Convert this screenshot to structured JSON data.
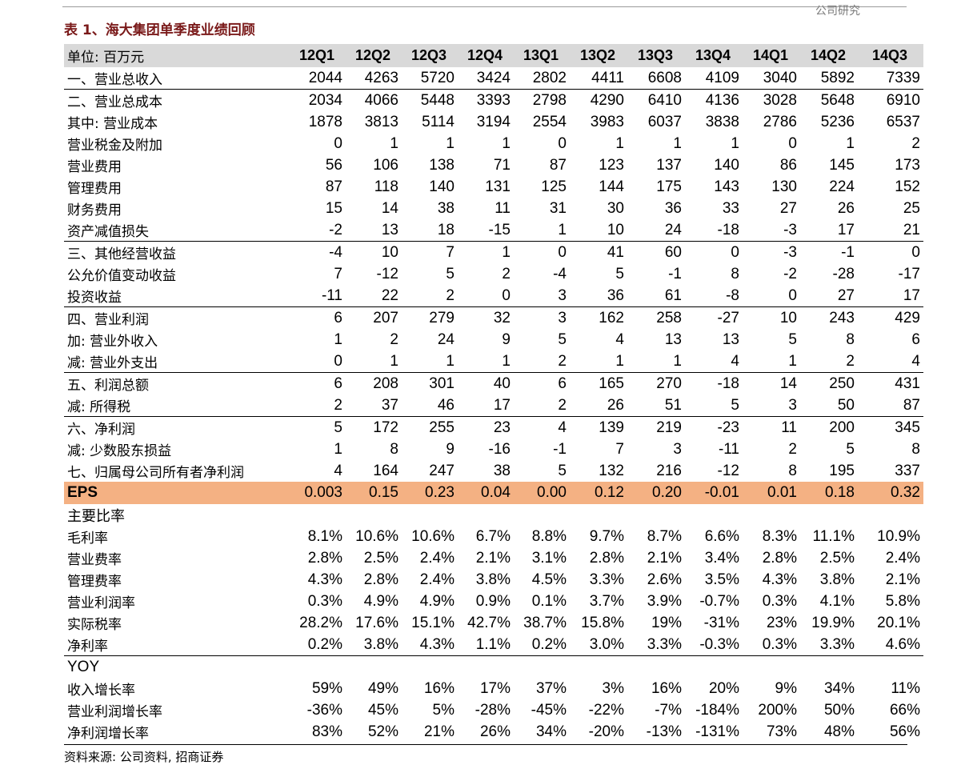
{
  "header_corner": "公司研究",
  "title": "表 1、海大集团单季度业绩回顾",
  "unit_label": "单位: 百万元",
  "quarters": [
    "12Q1",
    "12Q2",
    "12Q3",
    "12Q4",
    "13Q1",
    "13Q2",
    "13Q3",
    "13Q4",
    "14Q1",
    "14Q2",
    "14Q3"
  ],
  "rows": [
    {
      "label": "一、营业总收入",
      "values": [
        "2044",
        "4263",
        "5720",
        "3424",
        "2802",
        "4411",
        "6608",
        "4109",
        "3040",
        "5892",
        "7339"
      ]
    },
    {
      "label": "二、营业总成本",
      "values": [
        "2034",
        "4066",
        "5448",
        "3393",
        "2798",
        "4290",
        "6410",
        "4136",
        "3028",
        "5648",
        "6910"
      ]
    },
    {
      "label": "其中: 营业成本",
      "values": [
        "1878",
        "3813",
        "5114",
        "3194",
        "2554",
        "3983",
        "6037",
        "3838",
        "2786",
        "5236",
        "6537"
      ]
    },
    {
      "label": "营业税金及附加",
      "values": [
        "0",
        "1",
        "1",
        "1",
        "0",
        "1",
        "1",
        "1",
        "0",
        "1",
        "2"
      ]
    },
    {
      "label": "营业费用",
      "values": [
        "56",
        "106",
        "138",
        "71",
        "87",
        "123",
        "137",
        "140",
        "86",
        "145",
        "173"
      ]
    },
    {
      "label": "管理费用",
      "values": [
        "87",
        "118",
        "140",
        "131",
        "125",
        "144",
        "175",
        "143",
        "130",
        "224",
        "152"
      ]
    },
    {
      "label": "财务费用",
      "values": [
        "15",
        "14",
        "38",
        "11",
        "31",
        "30",
        "36",
        "33",
        "27",
        "26",
        "25"
      ]
    },
    {
      "label": "资产减值损失",
      "values": [
        "-2",
        "13",
        "18",
        "-15",
        "1",
        "10",
        "24",
        "-18",
        "-3",
        "17",
        "21"
      ]
    },
    {
      "label": "三、其他经营收益",
      "values": [
        "-4",
        "10",
        "7",
        "1",
        "0",
        "41",
        "60",
        "0",
        "-3",
        "-1",
        "0"
      ]
    },
    {
      "label": "公允价值变动收益",
      "values": [
        "7",
        "-12",
        "5",
        "2",
        "-4",
        "5",
        "-1",
        "8",
        "-2",
        "-28",
        "-17"
      ]
    },
    {
      "label": "投资收益",
      "values": [
        "-11",
        "22",
        "2",
        "0",
        "3",
        "36",
        "61",
        "-8",
        "0",
        "27",
        "17"
      ]
    },
    {
      "label": "四、营业利润",
      "values": [
        "6",
        "207",
        "279",
        "32",
        "3",
        "162",
        "258",
        "-27",
        "10",
        "243",
        "429"
      ]
    },
    {
      "label": "加: 营业外收入",
      "values": [
        "1",
        "2",
        "24",
        "9",
        "5",
        "4",
        "13",
        "13",
        "5",
        "8",
        "6"
      ]
    },
    {
      "label": "减: 营业外支出",
      "values": [
        "0",
        "1",
        "1",
        "1",
        "2",
        "1",
        "1",
        "4",
        "1",
        "2",
        "4"
      ]
    },
    {
      "label": "五、利润总额",
      "values": [
        "6",
        "208",
        "301",
        "40",
        "6",
        "165",
        "270",
        "-18",
        "14",
        "250",
        "431"
      ]
    },
    {
      "label": "减: 所得税",
      "values": [
        "2",
        "37",
        "46",
        "17",
        "2",
        "26",
        "51",
        "5",
        "3",
        "50",
        "87"
      ]
    },
    {
      "label": "六、净利润",
      "values": [
        "5",
        "172",
        "255",
        "23",
        "4",
        "139",
        "219",
        "-23",
        "11",
        "200",
        "345"
      ]
    },
    {
      "label": "减: 少数股东损益",
      "values": [
        "1",
        "8",
        "9",
        "-16",
        "-1",
        "7",
        "3",
        "-11",
        "2",
        "5",
        "8"
      ]
    },
    {
      "label": "七、归属母公司所有者净利润",
      "values": [
        "4",
        "164",
        "247",
        "38",
        "5",
        "132",
        "216",
        "-12",
        "8",
        "195",
        "337"
      ]
    }
  ],
  "eps": {
    "label": "EPS",
    "values": [
      "0.003",
      "0.15",
      "0.23",
      "0.04",
      "0.00",
      "0.12",
      "0.20",
      "-0.01",
      "0.01",
      "0.18",
      "0.32"
    ]
  },
  "ratios": {
    "heading": "主要比率",
    "rows": [
      {
        "label": "毛利率",
        "values": [
          "8.1%",
          "10.6%",
          "10.6%",
          "6.7%",
          "8.8%",
          "9.7%",
          "8.7%",
          "6.6%",
          "8.3%",
          "11.1%",
          "10.9%"
        ]
      },
      {
        "label": "营业费率",
        "values": [
          "2.8%",
          "2.5%",
          "2.4%",
          "2.1%",
          "3.1%",
          "2.8%",
          "2.1%",
          "3.4%",
          "2.8%",
          "2.5%",
          "2.4%"
        ]
      },
      {
        "label": "管理费率",
        "values": [
          "4.3%",
          "2.8%",
          "2.4%",
          "3.8%",
          "4.5%",
          "3.3%",
          "2.6%",
          "3.5%",
          "4.3%",
          "3.8%",
          "2.1%"
        ]
      },
      {
        "label": "营业利润率",
        "values": [
          "0.3%",
          "4.9%",
          "4.9%",
          "0.9%",
          "0.1%",
          "3.7%",
          "3.9%",
          "-0.7%",
          "0.3%",
          "4.1%",
          "5.8%"
        ]
      },
      {
        "label": "实际税率",
        "values": [
          "28.2%",
          "17.6%",
          "15.1%",
          "42.7%",
          "38.7%",
          "15.8%",
          "19%",
          "-31%",
          "23%",
          "19.9%",
          "20.1%"
        ]
      },
      {
        "label": "净利率",
        "values": [
          "0.2%",
          "3.8%",
          "4.3%",
          "1.1%",
          "0.2%",
          "3.0%",
          "3.3%",
          "-0.3%",
          "0.3%",
          "3.3%",
          "4.6%"
        ]
      }
    ]
  },
  "yoy": {
    "heading": "YOY",
    "rows": [
      {
        "label": "收入增长率",
        "values": [
          "59%",
          "49%",
          "16%",
          "17%",
          "37%",
          "3%",
          "16%",
          "20%",
          "9%",
          "34%",
          "11%"
        ]
      },
      {
        "label": "营业利润增长率",
        "values": [
          "-36%",
          "45%",
          "5%",
          "-28%",
          "-45%",
          "-22%",
          "-7%",
          "-184%",
          "200%",
          "50%",
          "66%"
        ]
      },
      {
        "label": "净利润增长率",
        "values": [
          "83%",
          "52%",
          "21%",
          "26%",
          "34%",
          "-20%",
          "-13%",
          "-131%",
          "73%",
          "48%",
          "56%"
        ]
      }
    ]
  },
  "source": "资料来源: 公司资料, 招商证券"
}
